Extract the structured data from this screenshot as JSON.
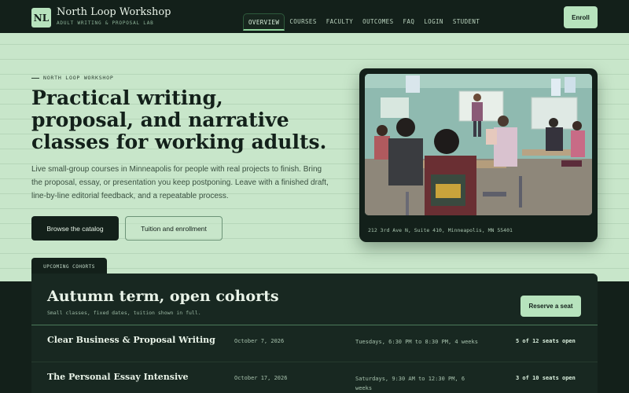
{
  "header": {
    "logo_initials": "NL",
    "brand_name": "North Loop Workshop",
    "brand_tagline": "ADULT WRITING & PROPOSAL LAB",
    "nav": [
      "OVERVIEW",
      "COURSES",
      "FACULTY",
      "OUTCOMES",
      "FAQ",
      "LOGIN",
      "STUDENT"
    ],
    "active_nav": "OVERVIEW",
    "enroll_label": "Enroll"
  },
  "hero": {
    "eyebrow": "NORTH LOOP WORKSHOP",
    "headline": "Practical writing, proposal, and narrative classes for working adults.",
    "intro": "Live small-group courses in Minneapolis for people with real projects to finish. Bring the proposal, essay, or presentation you keep postponing. Leave with a finished draft, line-by-line editorial feedback, and a repeatable process.",
    "primary_cta": "Browse the catalog",
    "secondary_cta": "Tuition and enrollment"
  },
  "photo": {
    "caption": "212 3rd Ave N, Suite 410, Minneapolis, MN 55401"
  },
  "cohorts": {
    "tab_label": "UPCOMING COHORTS",
    "title": "Autumn term, open cohorts",
    "subtitle": "Small classes, fixed dates, tuition shown in full.",
    "reserve_label": "Reserve a seat",
    "rows": [
      {
        "name": "Clear Business & Proposal Writing",
        "date": "October 7, 2026",
        "time": "Tuesdays, 6:30 PM to 8:30 PM, 4 weeks",
        "seats": "5 of 12 seats open"
      },
      {
        "name": "The Personal Essay Intensive",
        "date": "October 17, 2026",
        "time": "Saturdays, 9:30 AM to 12:30 PM, 6 weeks",
        "seats": "3 of 10 seats open"
      }
    ]
  },
  "colors": {
    "page_bg": "#c8e6ca",
    "dark": "#13201a",
    "accent": "#b7e3bd"
  }
}
